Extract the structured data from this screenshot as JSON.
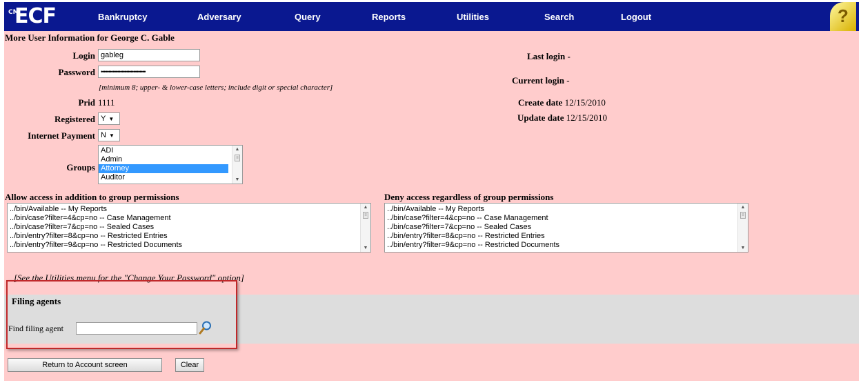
{
  "nav": {
    "logo_small": "CM",
    "logo": "ECF",
    "items": [
      "Bankruptcy",
      "Adversary",
      "Query",
      "Reports",
      "Utilities",
      "Search",
      "Logout"
    ],
    "help": "?"
  },
  "page": {
    "title": "More User Information for George C. Gable"
  },
  "form": {
    "login_label": "Login",
    "login_value": "gableg",
    "password_label": "Password",
    "password_value": "••••••••••••••••••••••••••••••",
    "password_hint": "[minimum 8; upper- & lower-case letters; include digit or special character]",
    "prid_label": "Prid",
    "prid_value": "1111",
    "registered_label": "Registered",
    "registered_value": "Y",
    "internet_payment_label": "Internet Payment",
    "internet_payment_value": "N",
    "groups_label": "Groups",
    "groups_options": [
      "ADI",
      "Admin",
      "Attorney",
      "Auditor"
    ],
    "groups_selected": "Attorney"
  },
  "info": {
    "last_login_label": "Last login",
    "last_login_value": "-",
    "current_login_label": "Current login",
    "current_login_value": "-",
    "create_date_label": "Create date",
    "create_date_value": "12/15/2010",
    "update_date_label": "Update date",
    "update_date_value": "12/15/2010"
  },
  "access": {
    "allow_title": "Allow access in addition to group permissions",
    "deny_title": "Deny access regardless of group permissions",
    "paths": [
      "../bin/Available -- My Reports",
      "../bin/case?filter=4&cp=no -- Case Management",
      "../bin/case?filter=7&cp=no -- Sealed Cases",
      "../bin/entry?filter=8&cp=no -- Restricted Entries",
      "../bin/entry?filter=9&cp=no -- Restricted Documents"
    ]
  },
  "utilities_note": "[See the Utilities menu for the \"Change Your Password\" option]",
  "filing": {
    "title": "Filing agents",
    "find_label": "Find filing agent",
    "find_value": ""
  },
  "buttons": {
    "return": "Return to Account screen",
    "clear": "Clear"
  },
  "colors": {
    "nav_bg": "#0a1890",
    "page_bg": "#ffcccc",
    "band_bg": "#dddddd",
    "highlight": "#c0282a",
    "selection": "#3399ff"
  }
}
